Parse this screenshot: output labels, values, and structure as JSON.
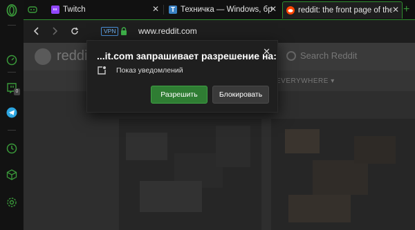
{
  "tabs": [
    {
      "title": "Twitch",
      "icon": "twitch-icon",
      "color": "#9146ff",
      "active": false
    },
    {
      "title": "Техничка — Windows, бра",
      "icon": "techichka-icon",
      "color": "#3b82c4",
      "active": false
    },
    {
      "title": "reddit: the front page of the",
      "icon": "reddit-icon",
      "color": "#ff4500",
      "active": true
    }
  ],
  "toolbar": {
    "vpn_label": "VPN",
    "url": "www.reddit.com"
  },
  "sidebar": {
    "twitch_badge": "0"
  },
  "page": {
    "brand_text": "reddit",
    "search_placeholder": "Search Reddit",
    "everywhere_label": "EVERYWHERE ▾"
  },
  "dialog": {
    "title": "...it.com запрашивает разрешение на:",
    "permission": "Показ уведомлений",
    "allow_label": "Разрешить",
    "block_label": "Блокировать",
    "close_glyph": "✕"
  },
  "colors": {
    "accent": "#2f8f2f",
    "allow_button": "#2f7d33"
  }
}
